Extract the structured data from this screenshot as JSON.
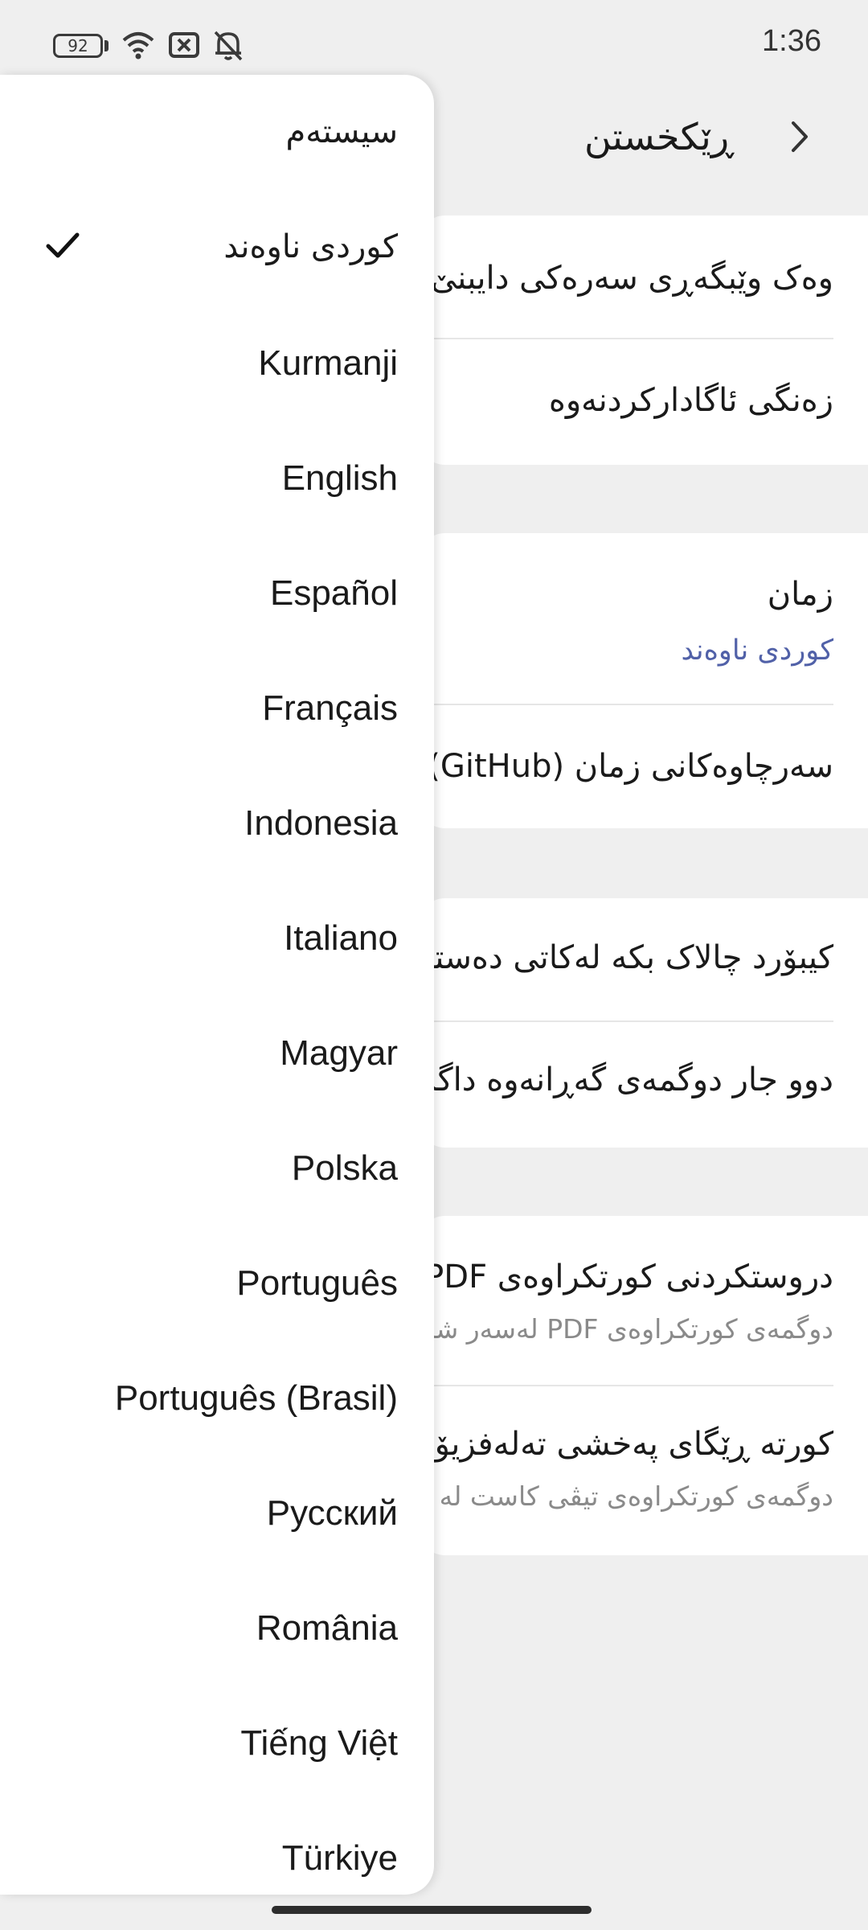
{
  "status_bar": {
    "battery_level": "92",
    "time": "1:36",
    "icons": [
      "battery-icon",
      "wifi-icon",
      "data-off-icon",
      "notifications-off-icon"
    ]
  },
  "header": {
    "title": "ڕێکخستن",
    "back_icon": "chevron-right-icon"
  },
  "settings": {
    "group1": {
      "row1": "وەک وێبگەڕی سەرەکی دایبنێ",
      "row2": "زەنگی ئاگادارکردنەوە"
    },
    "group2": {
      "language_title": "زمان",
      "language_value": "کوردی ناوەند",
      "sources": "سەرچاوەکانی زمان (GitHub)"
    },
    "group3": {
      "row1": "کیبۆرد چالاک بکە لەکاتی دەستپێکردن",
      "row2": "دوو جار دوگمەی گەڕانەوە داگرە"
    },
    "group4": {
      "pdf_title": "دروستکردنی کورتکراوەی PDF",
      "pdf_sub": "دوگمەی کورتکراوەی PDF لەسەر شاشە",
      "tv_title": "کورتە ڕێگای پەخشی تەلەفزیۆنی",
      "tv_sub": "دوگمەی کورتکراوەی تیڤی کاست لە"
    }
  },
  "language_menu": {
    "selected_index": 1,
    "items": [
      "سیستەم",
      "کوردی ناوەند",
      "Kurmanji",
      "English",
      "Español",
      "Français",
      "Indonesia",
      "Italiano",
      "Magyar",
      "Polska",
      "Português",
      "Português (Brasil)",
      "Русский",
      "România",
      "Tiếng Việt",
      "Türkiye"
    ]
  }
}
